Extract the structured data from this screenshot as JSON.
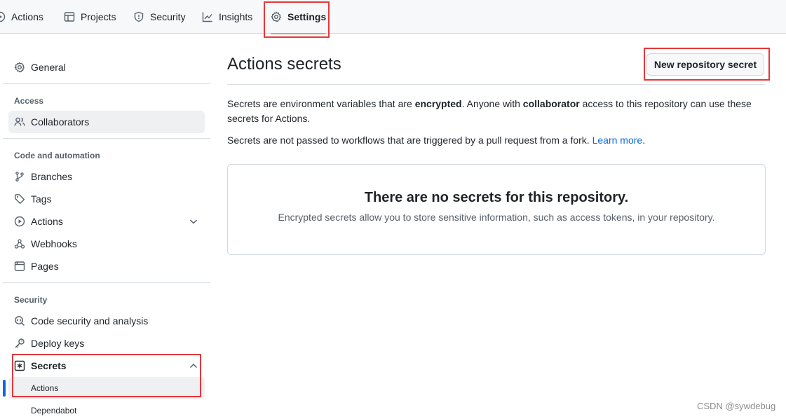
{
  "nav": {
    "tabs": [
      {
        "label": "Actions",
        "icon": "play-icon"
      },
      {
        "label": "Projects",
        "icon": "table-icon"
      },
      {
        "label": "Security",
        "icon": "shield-icon"
      },
      {
        "label": "Insights",
        "icon": "graph-icon"
      },
      {
        "label": "Settings",
        "icon": "gear-icon",
        "active": true
      }
    ]
  },
  "sidebar": {
    "general": "General",
    "access_heading": "Access",
    "collaborators": "Collaborators",
    "code_heading": "Code and automation",
    "branches": "Branches",
    "tags": "Tags",
    "actions": "Actions",
    "webhooks": "Webhooks",
    "pages": "Pages",
    "security_heading": "Security",
    "code_security": "Code security and analysis",
    "deploy_keys": "Deploy keys",
    "secrets": "Secrets",
    "secrets_actions": "Actions",
    "secrets_dependabot": "Dependabot"
  },
  "main": {
    "title": "Actions secrets",
    "new_button": "New repository secret",
    "desc1_a": "Secrets are environment variables that are ",
    "desc1_b": "encrypted",
    "desc1_c": ". Anyone with ",
    "desc1_d": "collaborator",
    "desc1_e": " access to this repository can use these secrets for Actions.",
    "desc2": "Secrets are not passed to workflows that are triggered by a pull request from a fork. ",
    "learn_more": "Learn more",
    "desc2_end": ".",
    "empty_title": "There are no secrets for this repository.",
    "empty_desc": "Encrypted secrets allow you to store sensitive information, such as access tokens, in your repository."
  },
  "watermark": "CSDN @sywdebug",
  "colors": {
    "accent": "#0969da",
    "highlight": "#e5383b",
    "tab_underline": "#fd8c73"
  }
}
